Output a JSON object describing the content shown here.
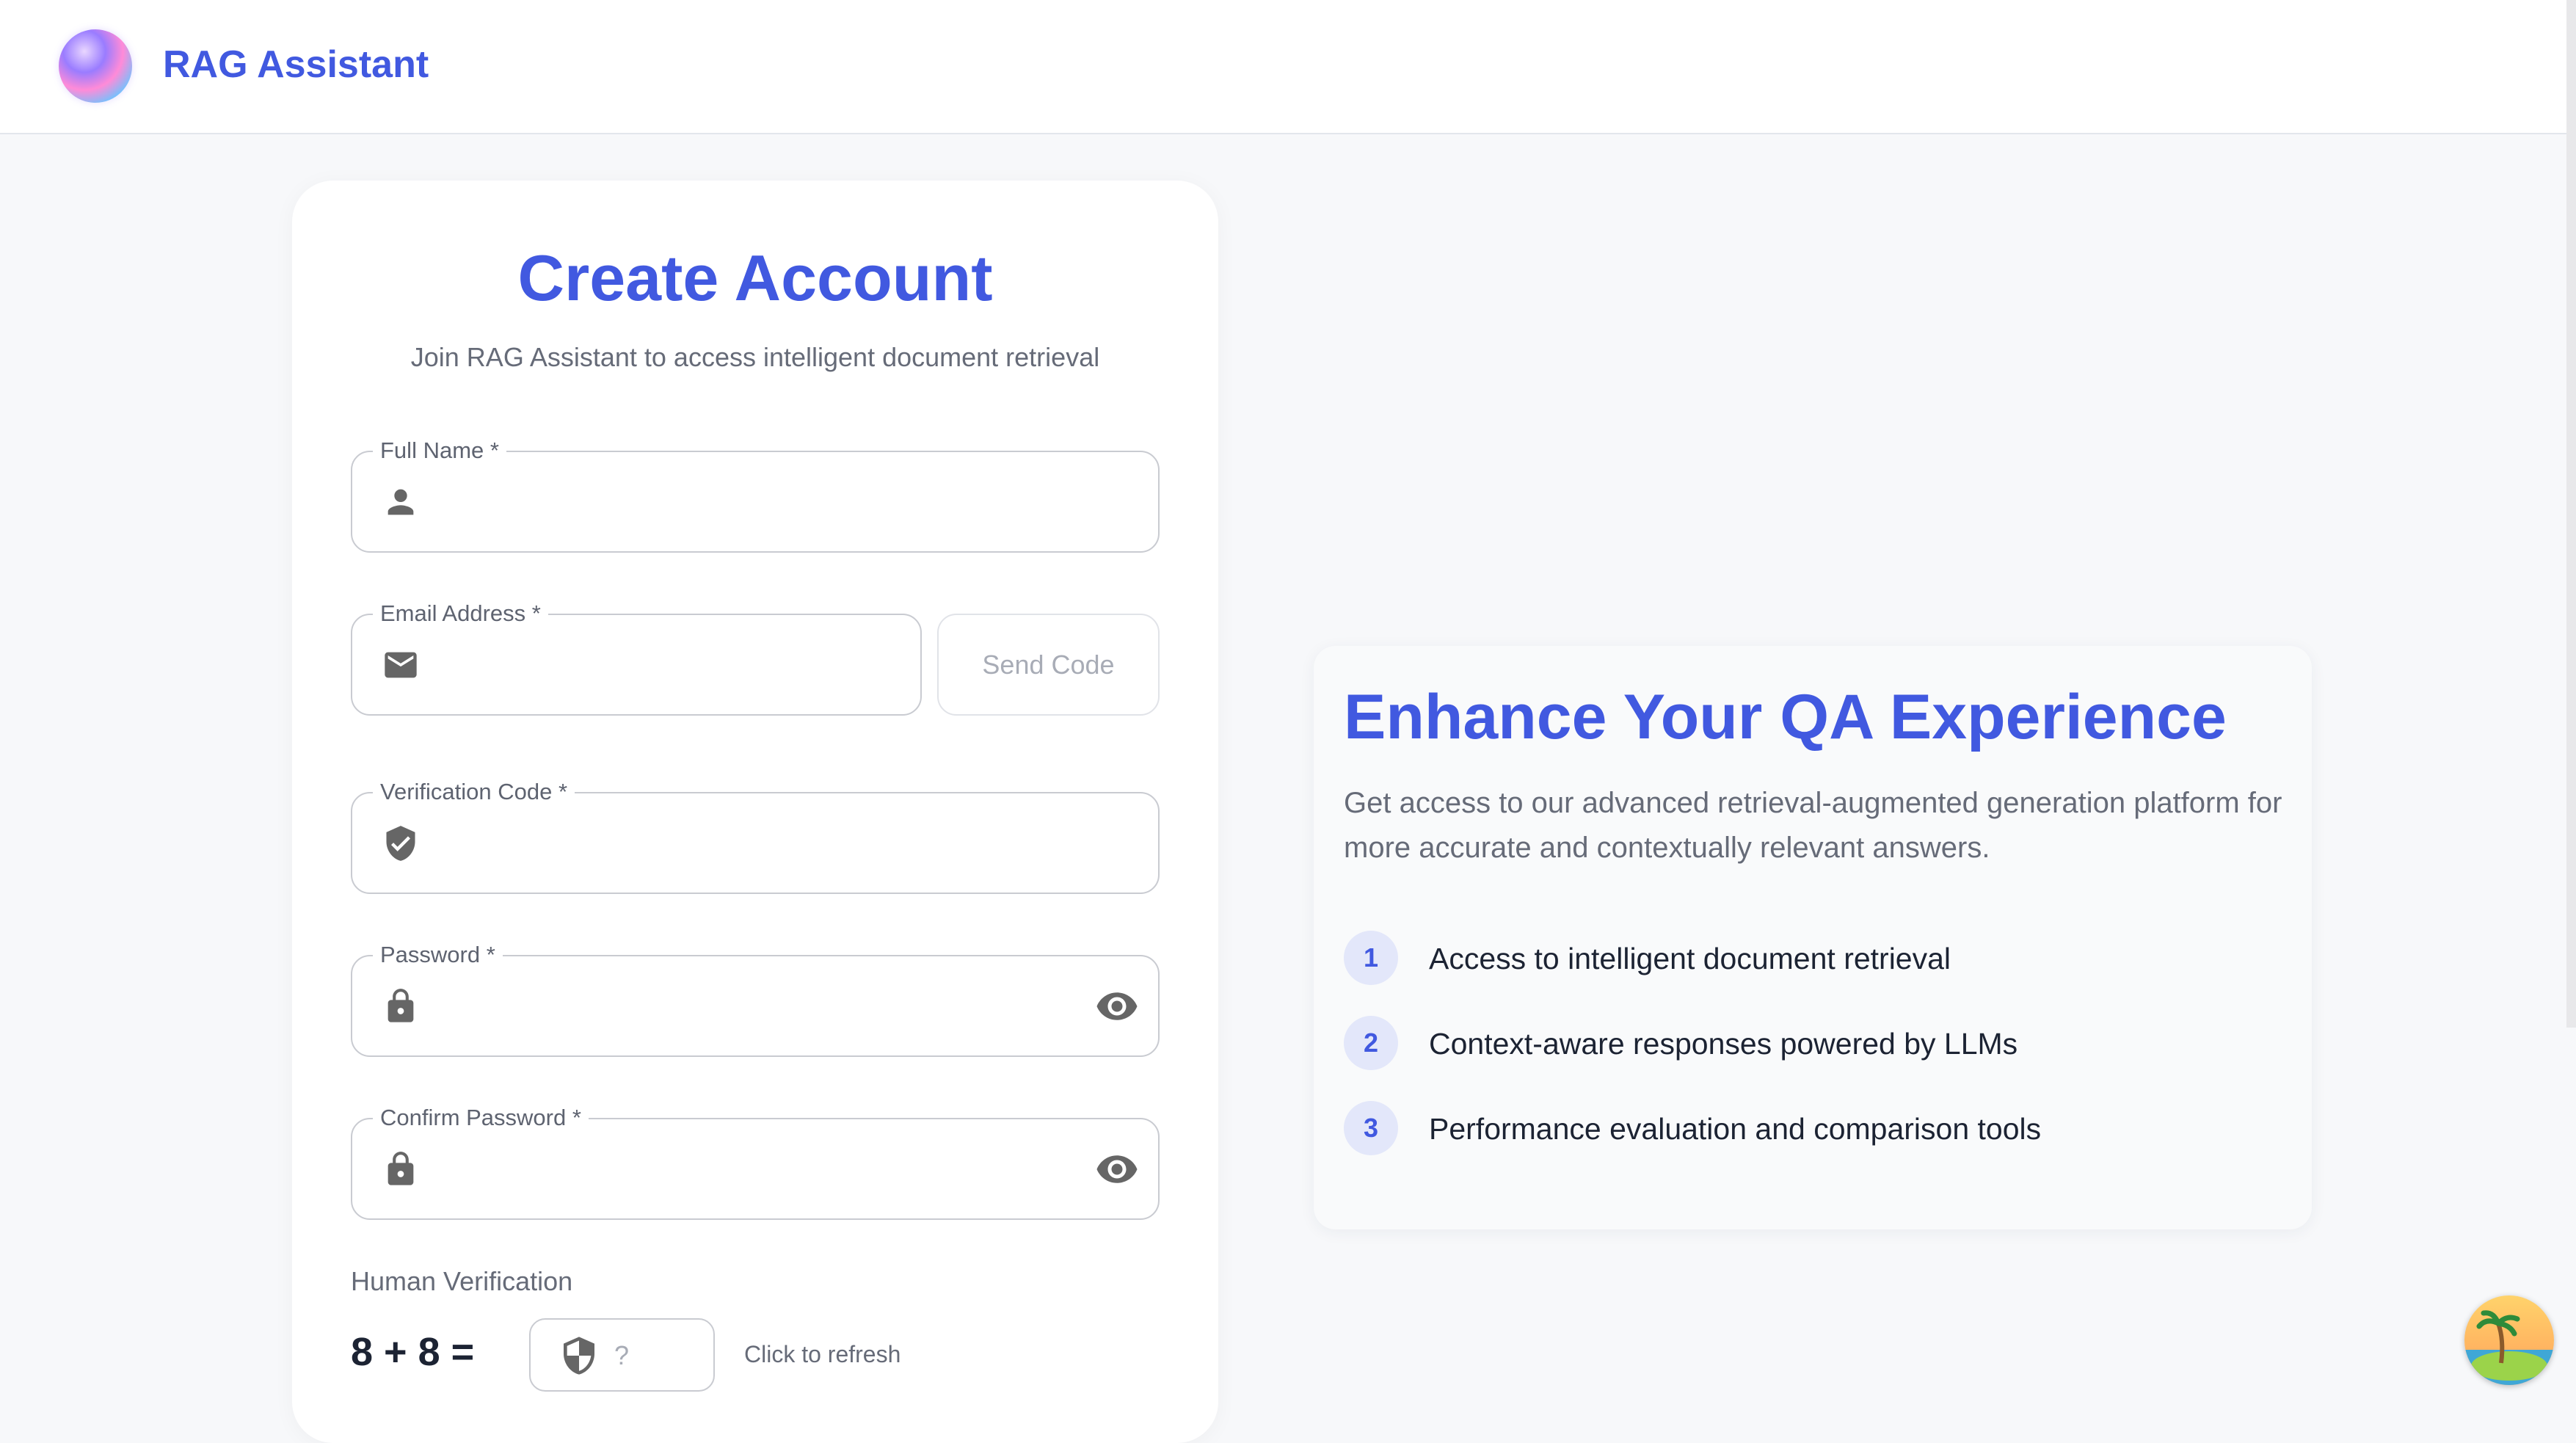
{
  "header": {
    "app_title": "RAG Assistant"
  },
  "signup": {
    "title": "Create Account",
    "subtitle": "Join RAG Assistant to access intelligent document retrieval",
    "fields": {
      "full_name": {
        "label": "Full Name *",
        "value": ""
      },
      "email": {
        "label": "Email Address *",
        "value": ""
      },
      "verification_code": {
        "label": "Verification Code *",
        "value": ""
      },
      "password": {
        "label": "Password *",
        "value": ""
      },
      "confirm_password": {
        "label": "Confirm Password *",
        "value": ""
      }
    },
    "send_code_label": "Send Code",
    "human_verification": {
      "label": "Human Verification",
      "question": "8 + 8 =",
      "placeholder": "?",
      "refresh_label": "Click to refresh"
    }
  },
  "promo": {
    "title": "Enhance Your QA Experience",
    "description": "Get access to our advanced retrieval-augmented generation platform for more accurate and contextually relevant answers.",
    "features": [
      {
        "number": "1",
        "text": "Access to intelligent document retrieval"
      },
      {
        "number": "2",
        "text": "Context-aware responses powered by LLMs"
      },
      {
        "number": "3",
        "text": "Performance evaluation and comparison tools"
      }
    ]
  },
  "colors": {
    "accent": "#4159e0",
    "background": "#f7f8fa",
    "text_muted": "#666b78",
    "text_dark": "#1c2333",
    "border": "#c9cbd1"
  },
  "icons": {
    "logo": "logo-orb-icon",
    "full_name": "person-icon",
    "email": "mail-icon",
    "verification_code": "verified-shield-icon",
    "password": "lock-icon",
    "password_toggle": "eye-icon",
    "captcha": "shield-icon",
    "avatar": "beach-avatar-icon"
  }
}
